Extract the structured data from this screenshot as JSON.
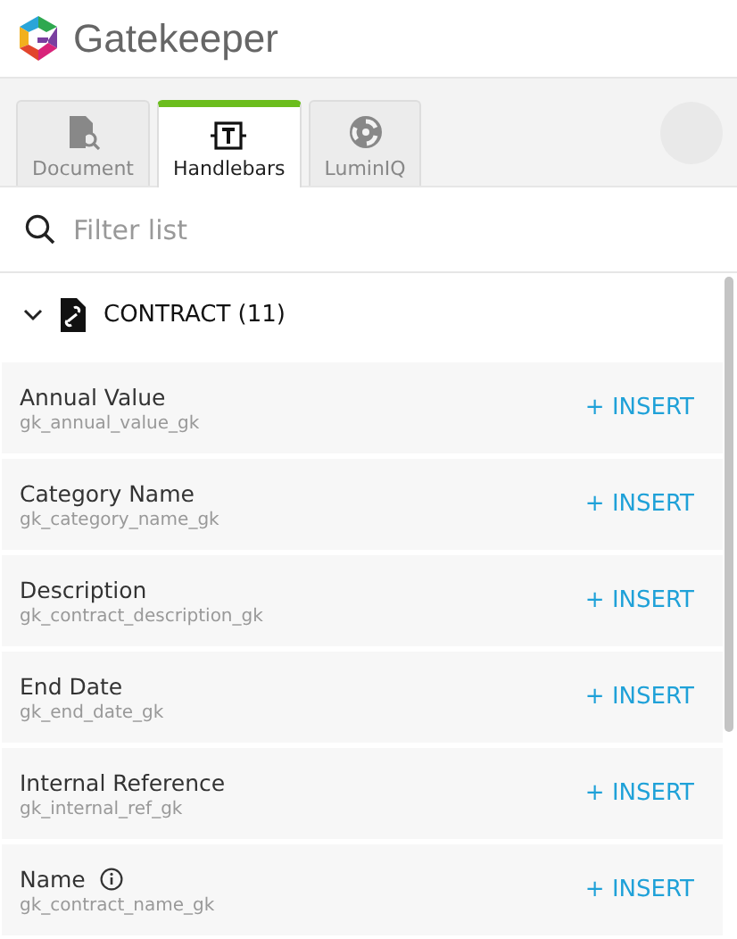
{
  "app": {
    "title": "Gatekeeper"
  },
  "tabs": [
    {
      "label": "Document",
      "kind": "document",
      "selected": false
    },
    {
      "label": "Handlebars",
      "kind": "handlebars",
      "selected": true
    },
    {
      "label": "LuminIQ",
      "kind": "luminiq",
      "selected": false
    }
  ],
  "search": {
    "placeholder": "Filter list"
  },
  "section": {
    "title": "CONTRACT (11)",
    "expanded": true,
    "fields": [
      {
        "name": "Annual Value",
        "key": "gk_annual_value_gk",
        "info": false,
        "action": "+ INSERT"
      },
      {
        "name": "Category Name",
        "key": "gk_category_name_gk",
        "info": false,
        "action": "+ INSERT"
      },
      {
        "name": "Description",
        "key": "gk_contract_description_gk",
        "info": false,
        "action": "+ INSERT"
      },
      {
        "name": "End Date",
        "key": "gk_end_date_gk",
        "info": false,
        "action": "+ INSERT"
      },
      {
        "name": "Internal Reference",
        "key": "gk_internal_ref_gk",
        "info": false,
        "action": "+ INSERT"
      },
      {
        "name": "Name",
        "key": "gk_contract_name_gk",
        "info": true,
        "action": "+ INSERT"
      }
    ]
  }
}
